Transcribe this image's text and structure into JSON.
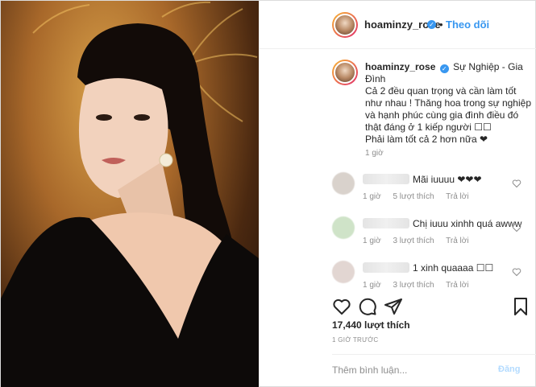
{
  "header": {
    "username": "hoaminzy_rose",
    "dot": "•",
    "follow_label": "Theo dõi"
  },
  "caption": {
    "username": "hoaminzy_rose",
    "title": "Sự Nghiệp - Gia Đình",
    "body_lines": [
      "Cả 2 đều quan trọng và cần làm tốt",
      "như nhau ! Thăng hoa trong sự nghiệp",
      "và hạnh phúc cùng gia đình điều đó",
      "thật đáng ở 1 kiếp người ☐☐",
      "Phải làm tốt cả 2 hơn nữa ❤"
    ],
    "time": "1 giờ"
  },
  "comments": [
    {
      "text": "Mãi iuuuu ❤❤❤",
      "time": "1 giờ",
      "likes": "5 lượt thích",
      "reply": "Trả lời"
    },
    {
      "text": "Chị iuuu xinhh quá awww",
      "time": "1 giờ",
      "likes": "3 lượt thích",
      "reply": "Trả lời"
    },
    {
      "text": "1 xinh quaaaa ☐☐",
      "time": "1 giờ",
      "likes": "3 lượt thích",
      "reply": "Trả lời"
    }
  ],
  "actions": {
    "like_icon": "heart-icon",
    "comment_icon": "comment-icon",
    "share_icon": "share-icon",
    "save_icon": "bookmark-icon"
  },
  "likes": "17,440 lượt thích",
  "posted_ago": "1 GIỜ TRƯỚC",
  "comment_box": {
    "placeholder": "Thêm bình luận...",
    "post_label": "Đăng"
  },
  "colors": {
    "accent": "#3897f0",
    "post_disabled": "#b3dbff",
    "muted": "#8e8e8e"
  }
}
